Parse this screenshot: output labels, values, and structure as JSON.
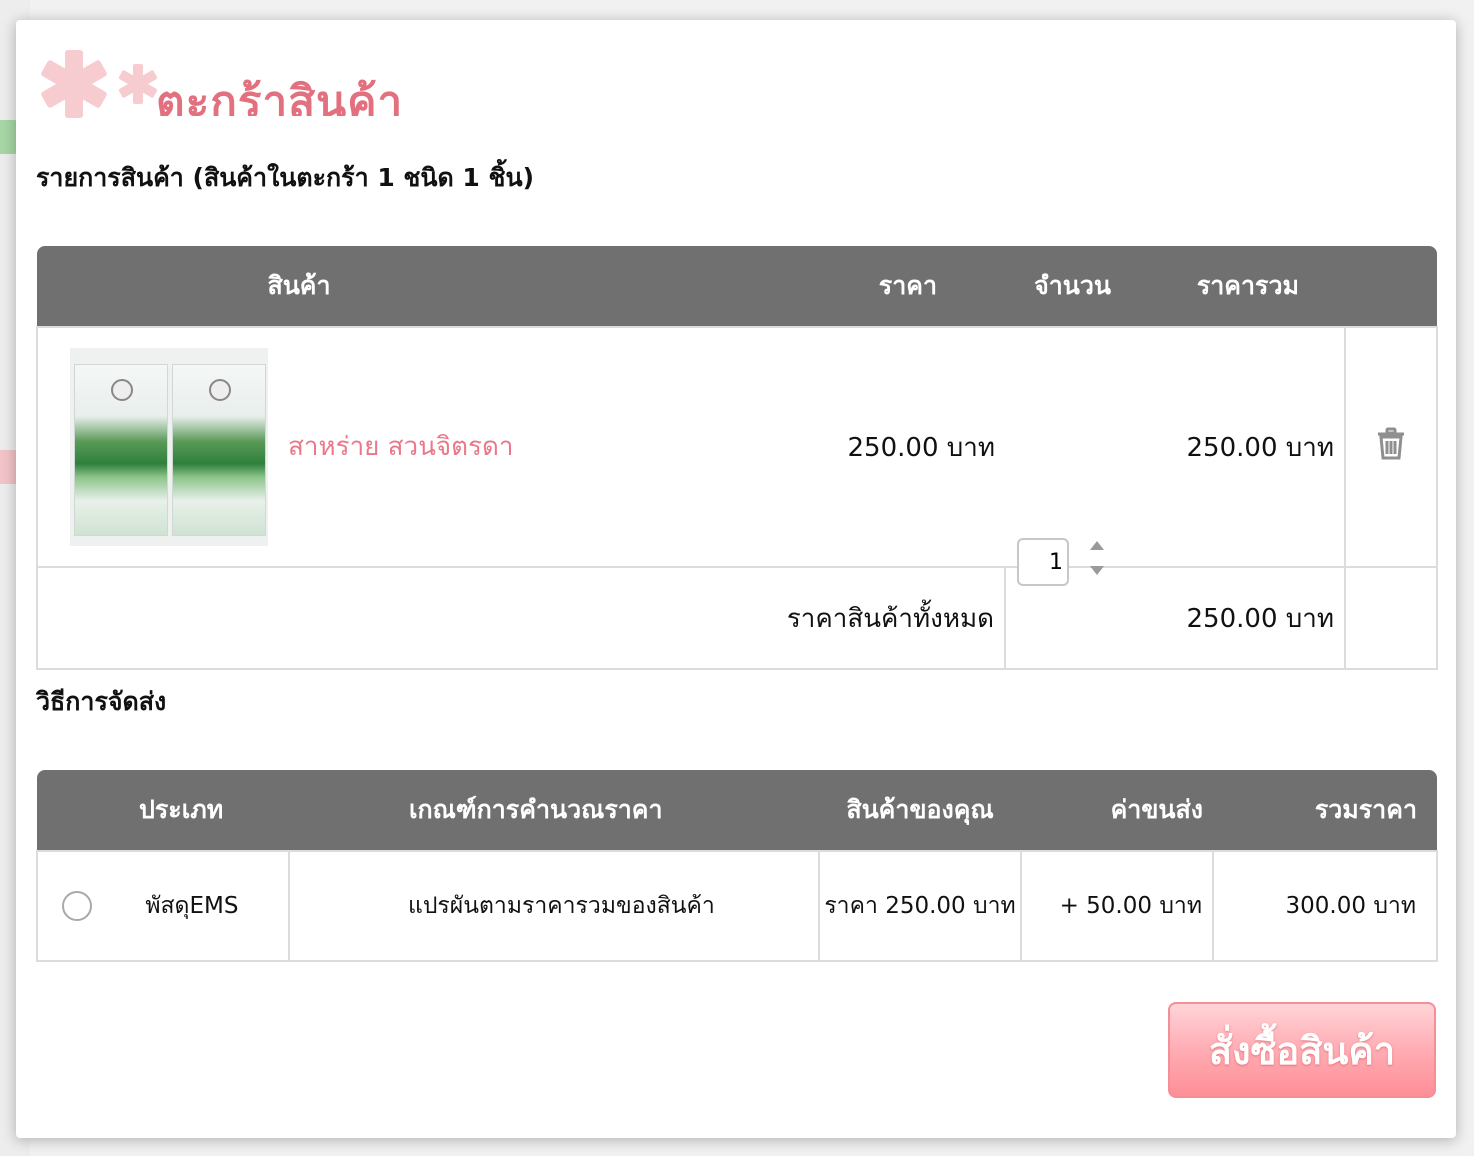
{
  "modal": {
    "title": "ตะกร้าสินค้า"
  },
  "cart": {
    "summary": "รายการสินค้า (สินค้าในตะกร้า 1 ชนิด 1 ชิ้น)",
    "headers": {
      "product": "สินค้า",
      "price": "ราคา",
      "quantity": "จำนวน",
      "subtotal": "ราคารวม"
    },
    "items": [
      {
        "name": "สาหร่าย สวนจิตรดา",
        "image_icon": "spirulina-product-image",
        "price": "250.00 บาท",
        "quantity": "1",
        "subtotal": "250.00 บาท",
        "delete_icon": "trash-icon"
      }
    ],
    "total_label": "ราคาสินค้าทั้งหมด",
    "total_value": "250.00 บาท"
  },
  "shipping": {
    "title": "วิธีการจัดส่ง",
    "headers": {
      "type": "ประเภท",
      "criteria": "เกณฑ์การคำนวณราคา",
      "your_items": "สินค้าของคุณ",
      "fee": "ค่าขนส่ง",
      "total": "รวมราคา"
    },
    "options": [
      {
        "type": "พัสดุEMS",
        "criteria": "แปรผันตามราคารวมของสินค้า",
        "your_items": "ราคา 250.00 บาท",
        "fee": "+ 50.00 บาท",
        "total": "300.00 บาท",
        "selected": false
      }
    ]
  },
  "actions": {
    "order_label": "สั่งซื้อสินค้า"
  },
  "colors": {
    "accent": "#e2707e",
    "header_bg": "#707070",
    "button": "#ff9aa3"
  }
}
